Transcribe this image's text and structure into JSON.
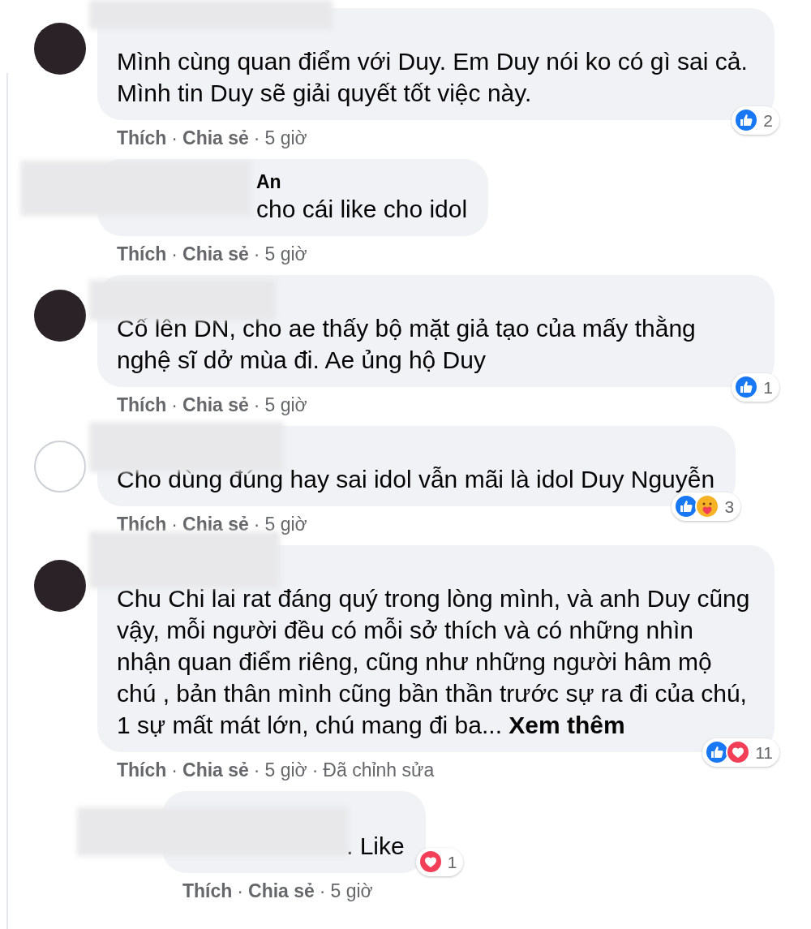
{
  "separator": "·",
  "comments": [
    {
      "kind": "comment",
      "avatar": {
        "kind": "dark"
      },
      "text": "Mình cùng quan điểm với Duy. Em Duy nói ko có gì sai cả. Mình tin Duy sẽ giải quyết tốt việc này.",
      "reactions": {
        "items": [
          {
            "kind": "like"
          }
        ],
        "count": "2"
      },
      "actions": [
        "Thích",
        "Chia sẻ"
      ],
      "time": "5 giờ"
    },
    {
      "kind": "comment",
      "author": "An",
      "text": "cho cái like cho idol",
      "actions": [
        "Thích",
        "Chia sẻ"
      ],
      "time": "5 giờ"
    },
    {
      "kind": "comment",
      "avatar": {
        "kind": "dark"
      },
      "text": "Cố lên DN, cho ae thấy bộ mặt giả tạo của mấy thằng nghệ sĩ dở mùa đi. Ae ủng hộ Duy",
      "reactions": {
        "items": [
          {
            "kind": "like"
          }
        ],
        "count": "1"
      },
      "actions": [
        "Thích",
        "Chia sẻ"
      ],
      "time": "5 giờ"
    },
    {
      "kind": "comment",
      "avatar": {
        "kind": "light"
      },
      "text": "Cho dùng đúng hay sai idol vẫn mãi là idol Duy Nguyễn",
      "reactions": {
        "items": [
          {
            "kind": "like"
          },
          {
            "kind": "care"
          }
        ],
        "count": "3"
      },
      "actions": [
        "Thích",
        "Chia sẻ"
      ],
      "time": "5 giờ"
    },
    {
      "kind": "comment",
      "avatar": {
        "kind": "dark"
      },
      "text": "Chu Chi lai rat đáng quý trong lòng mình, và anh Duy cũng vậy, mỗi người đều có mỗi sở thích và có những nhìn nhận quan điểm riêng, cũng như những người hâm mộ chú , bản thân mình cũng bần thần trước sự ra đi của chú, 1 sự mất mát lớn, chú mang đi ba...",
      "see_more": "Xem thêm",
      "reactions": {
        "items": [
          {
            "kind": "like"
          },
          {
            "kind": "love"
          }
        ],
        "count": "11"
      },
      "actions": [
        "Thích",
        "Chia sẻ"
      ],
      "time": "5 giờ",
      "edited": "Đã chỉnh sửa"
    },
    {
      "kind": "reply",
      "text": ". Like",
      "reactions": {
        "items": [
          {
            "kind": "love"
          }
        ],
        "count": "1"
      },
      "actions": [
        "Thích",
        "Chia sẻ"
      ],
      "time": "5 giờ"
    }
  ]
}
